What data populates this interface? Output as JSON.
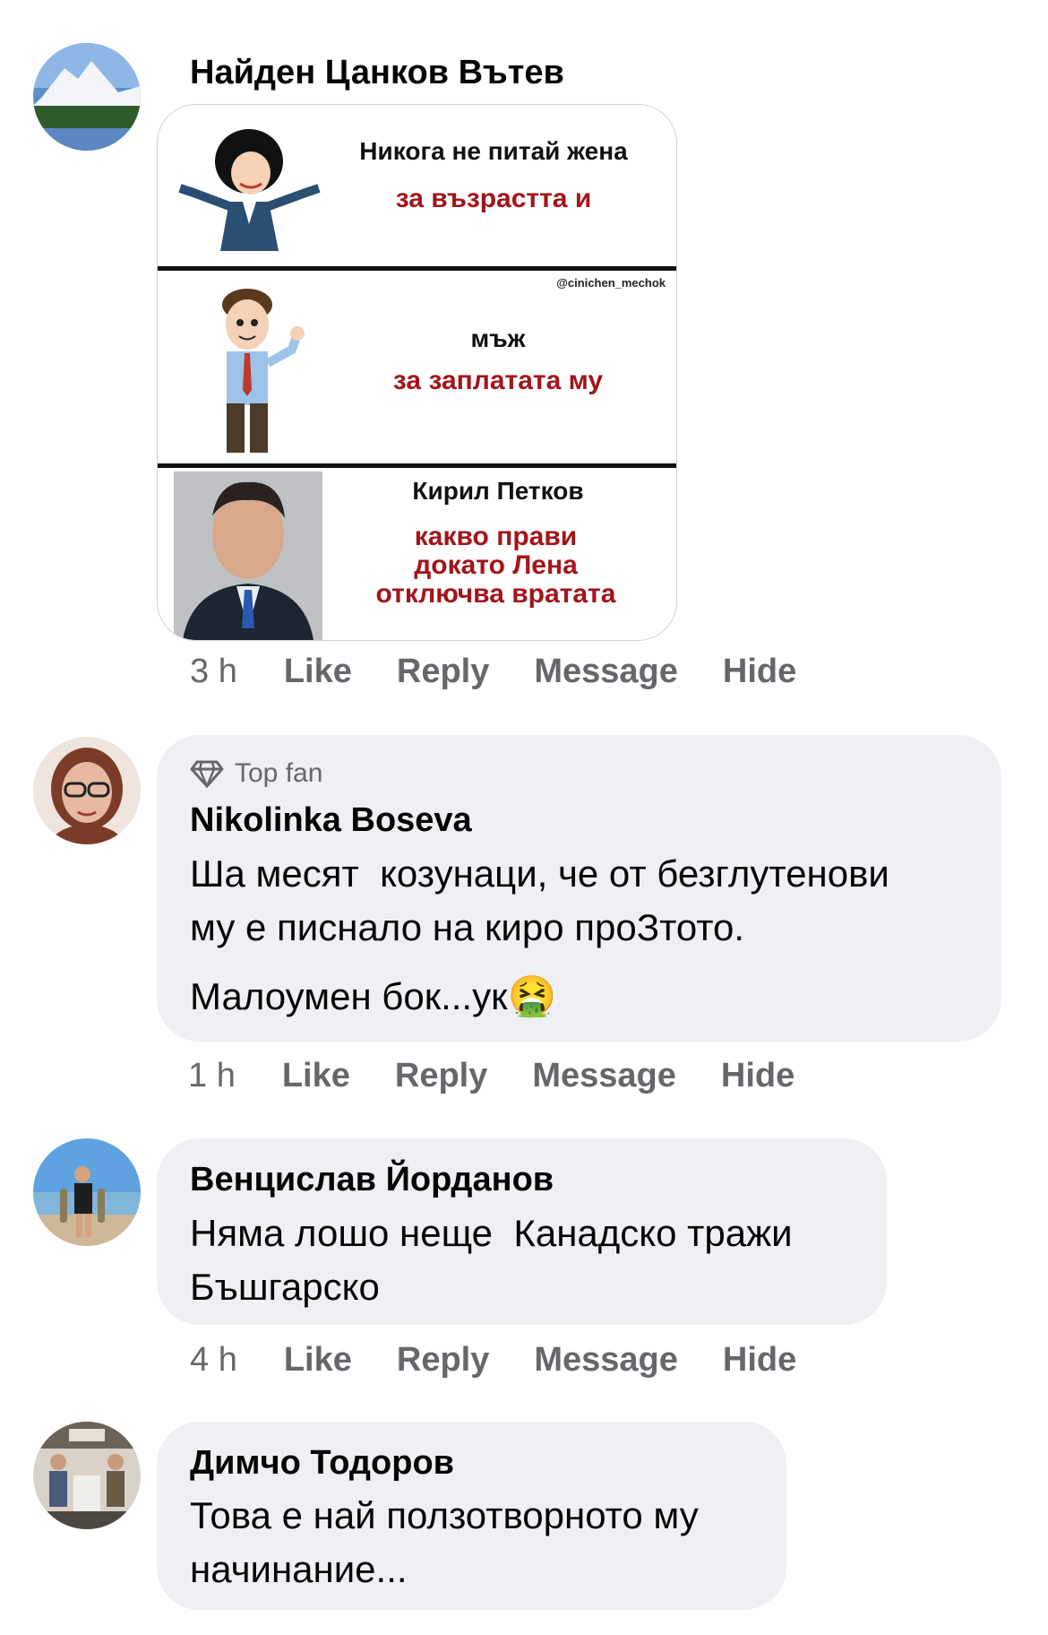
{
  "comments": [
    {
      "author": "Найден Цанков Вътев",
      "meme": {
        "panel1_line1": "Никога не питай жена",
        "panel1_line2": "за възрастта и",
        "watermark": "@cinichen_mechok",
        "panel2_line1": "мъж",
        "panel2_line2": "за заплатата му",
        "panel3_line1": "Кирил Петков",
        "panel3_line2": "какво прави",
        "panel3_line3": "докато Лена",
        "panel3_line4": "отключва вратата"
      },
      "time": "3 h",
      "like": "Like",
      "reply": "Reply",
      "message": "Message",
      "hide": "Hide"
    },
    {
      "badge": "Top fan",
      "author": "Nikolinka Boseva",
      "text1": "Ша месят  козунаци, че от безглутенови",
      "text2": "му е писнало на киро проЗтото.",
      "text3": "Малоумен бок...ук",
      "emoji": "🤮",
      "time": "1 h",
      "like": "Like",
      "reply": "Reply",
      "message": "Message",
      "hide": "Hide"
    },
    {
      "author": "Венцислав Йорданов",
      "text1": "Няма лошо неще  Канадско тражи",
      "text2": "Бъшгарско",
      "time": "4 h",
      "like": "Like",
      "reply": "Reply",
      "message": "Message",
      "hide": "Hide"
    },
    {
      "author": "Димчо Тодоров",
      "text1": "Това е най ползотворното му",
      "text2": "начинание..."
    }
  ],
  "colors": {
    "red_text": "#a3141a",
    "bubble": "#eef0f3",
    "secondary": "#65676b"
  }
}
